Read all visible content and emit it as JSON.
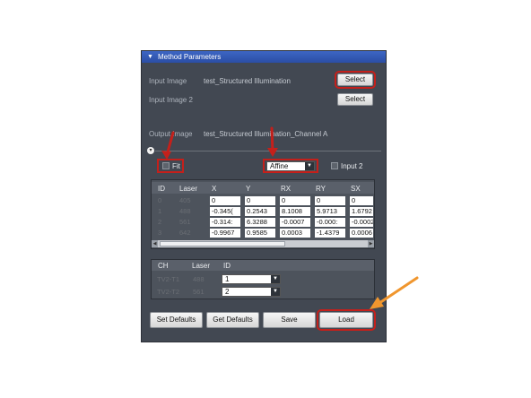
{
  "header": {
    "title": "Method Parameters",
    "arrow": "▼"
  },
  "input_image": {
    "label": "Input Image",
    "value": "test_Structured Illumination"
  },
  "input_image2": {
    "label": "Input Image 2"
  },
  "output_image": {
    "label": "Output Image",
    "value": "test_Structured Illumination_Channel A"
  },
  "buttons": {
    "select1": "Select",
    "select2": "Select",
    "set_defaults": "Set Defaults",
    "get_defaults": "Get Defaults",
    "save": "Save",
    "load": "Load"
  },
  "options": {
    "fit_label": "Fit",
    "fit_checked": false,
    "transform_value": "Affine",
    "input2_label": "Input 2",
    "input2_checked": false
  },
  "table1": {
    "columns": [
      "ID",
      "Laser",
      "X",
      "Y",
      "RX",
      "RY",
      "SX"
    ],
    "rows": [
      [
        "0",
        "405",
        "0",
        "0",
        "0",
        "0",
        "0"
      ],
      [
        "1",
        "488",
        "-0.345(",
        "0.2543",
        "8.1008",
        "5.9713",
        "1.6792"
      ],
      [
        "2",
        "561",
        "-0.314:",
        "6.3288",
        "-0.0007",
        "-0.000:",
        "-0.0002"
      ],
      [
        "3",
        "642",
        "-0.9967",
        "0.9585",
        "0.0003",
        "-1.4379",
        "0.0006"
      ]
    ]
  },
  "table2": {
    "columns": [
      "CH",
      "Laser",
      "ID"
    ],
    "rows": [
      [
        "TV2-T1",
        "488",
        "1"
      ],
      [
        "TV2-T2",
        "561",
        "2"
      ]
    ]
  },
  "colors": {
    "annotation_red": "#c4201b",
    "annotation_orange": "#f0962e",
    "panel": "#424852",
    "header": "#2b4ea5"
  }
}
